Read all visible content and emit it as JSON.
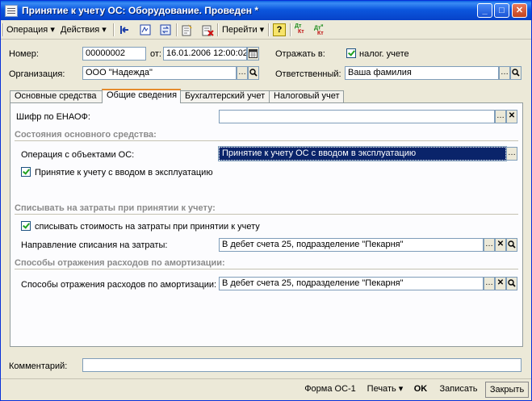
{
  "window": {
    "title": "Принятие к учету ОС: Оборудование. Проведен *",
    "controls": {
      "minimize": "_",
      "maximize": "□",
      "close": "✕"
    }
  },
  "toolbar": {
    "operation": "Операция",
    "actions": "Действия",
    "goto": "Перейти",
    "help": "?",
    "dtkt1_top": "Дт",
    "dtkt1_bottom": "Кт",
    "dtkt2_top": "Дт",
    "dtkt2_sup": "н",
    "dtkt2_bottom": "Кт"
  },
  "header": {
    "number_label": "Номер:",
    "number_value": "00000002",
    "date_label": "от:",
    "date_value": "16.01.2006 12:00:02",
    "reflect_label": "Отражать в:",
    "reflect_tax_label": "налог. учете",
    "reflect_tax_checked": true,
    "org_label": "Организация:",
    "org_value": "ООО \"Надежда\"",
    "resp_label": "Ответственный:",
    "resp_value": "Ваша фамилия"
  },
  "tabs": [
    {
      "label": "Основные средства",
      "active": false
    },
    {
      "label": "Общие сведения",
      "active": true
    },
    {
      "label": "Бухгалтерский учет",
      "active": false
    },
    {
      "label": "Налоговый учет",
      "active": false
    }
  ],
  "general": {
    "shifr_label": "Шифр по ЕНАОФ:",
    "shifr_value": "",
    "state_section": "Состояния основного средства:",
    "operation_label": "Операция с объектами ОС:",
    "operation_value": "Принятие к учету ОС с вводом в эксплуатацию",
    "commissioning_label": "Принятие к учету с вводом в эксплуатацию",
    "commissioning_checked": true,
    "expense_section": "Списывать на затраты при принятии к учету:",
    "writeoff_label": "списывать стоимость на затраты при принятии к учету",
    "writeoff_checked": true,
    "direction_label": "Направление списания на затраты:",
    "direction_value": "В дебет счета 25, подразделение \"Пекарня\"",
    "amort_section": "Способы отражения расходов по амортизации:",
    "amort_label": "Способы отражения расходов по амортизации:",
    "amort_value": "В дебет счета 25, подразделение \"Пекарня\""
  },
  "comment": {
    "label": "Комментарий:",
    "value": ""
  },
  "footer": {
    "form": "Форма ОС-1",
    "print": "Печать",
    "ok": "OK",
    "save": "Записать",
    "close": "Закрыть"
  }
}
